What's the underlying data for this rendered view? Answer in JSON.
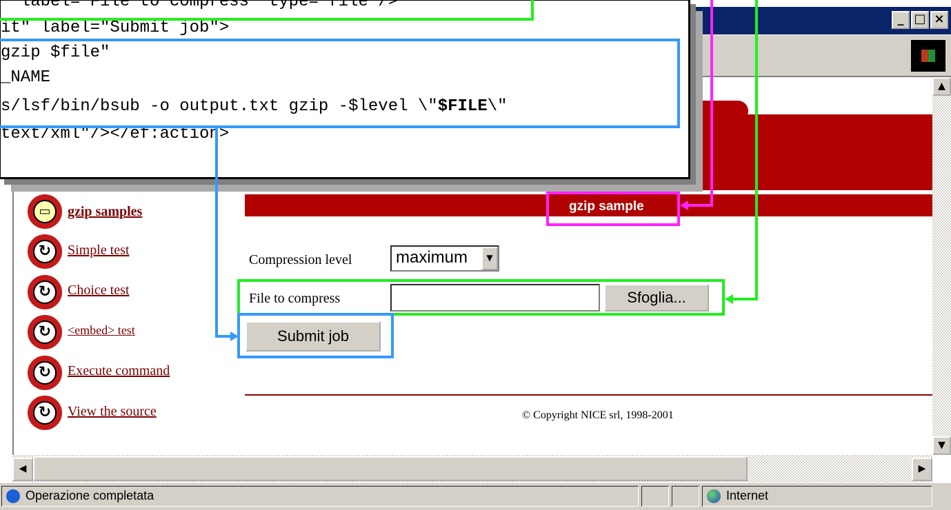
{
  "window": {
    "controls": [
      "minimize",
      "maximize",
      "close"
    ],
    "colors": {
      "titlebar": "#0a246a",
      "chrome": "#d4d0c8"
    }
  },
  "code_overlay": {
    "lines": [
      "  label=\"File to compress\" type=\"file\"/>",
      "it\" label=\"Submit job\">",
      "gzip $file\"",
      "_NAME",
      "s/lsf/bin/bsub -o output.txt gzip -$level \\\"",
      "$FILE",
      "\\\"",
      "text/xml\"/></ef:action>"
    ],
    "highlight_colors": {
      "file_field": "#22ee22",
      "submit_command": "#3399ff",
      "title": "#ff22ff"
    }
  },
  "sidebar": {
    "items": [
      {
        "label": "gzip samples",
        "icon": "folder-icon",
        "active": true
      },
      {
        "label": "Simple test",
        "icon": "refresh-icon"
      },
      {
        "label": "Choice test",
        "icon": "refresh-icon"
      },
      {
        "label": "<embed> test",
        "icon": "refresh-icon"
      },
      {
        "label": "Execute command",
        "icon": "refresh-icon"
      },
      {
        "label": "View the source",
        "icon": "refresh-icon"
      }
    ]
  },
  "main": {
    "header_title": "gzip sample",
    "compression": {
      "label": "Compression level",
      "selected": "maximum"
    },
    "file": {
      "label": "File to compress",
      "value": "",
      "browse_label": "Sfoglia..."
    },
    "submit_label": "Submit job",
    "copyright": "© Copyright NICE srl, 1998-2001",
    "colors": {
      "accent": "#b00000",
      "link": "#7a0000"
    }
  },
  "statusbar": {
    "message": "Operazione completata",
    "zone": "Internet"
  }
}
